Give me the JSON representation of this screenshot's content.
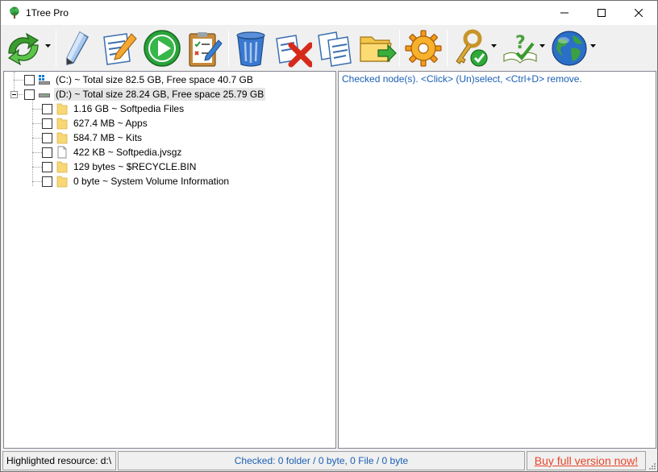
{
  "window": {
    "title": "1Tree Pro",
    "icon": "tree-icon"
  },
  "toolbar": {
    "buttons": [
      {
        "name": "refresh-icon",
        "dropdown": true
      },
      {
        "name": "pencil-icon",
        "dropdown": false
      },
      {
        "name": "edit-notes-icon",
        "dropdown": false
      },
      {
        "name": "play-icon",
        "dropdown": false
      },
      {
        "name": "checklist-icon",
        "dropdown": false
      },
      {
        "name": "trash-icon",
        "dropdown": false
      },
      {
        "name": "remove-icon",
        "dropdown": false
      },
      {
        "name": "copy-icon",
        "dropdown": false
      },
      {
        "name": "move-folder-icon",
        "dropdown": false
      },
      {
        "name": "settings-gear-icon",
        "dropdown": false
      },
      {
        "name": "key-register-icon",
        "dropdown": true
      },
      {
        "name": "help-icon",
        "dropdown": true
      },
      {
        "name": "globe-icon",
        "dropdown": true
      }
    ]
  },
  "tree": {
    "drives": [
      {
        "label": "(C:) ~ Total size 82.5 GB, Free space 40.7 GB",
        "icon": "windows-drive-icon"
      },
      {
        "label": "(D:) ~ Total size 28.24 GB, Free space 25.79 GB",
        "icon": "drive-icon",
        "expanded": true
      }
    ],
    "children": [
      {
        "label": "1.16 GB ~ Softpedia Files",
        "icon": "folder-icon"
      },
      {
        "label": "627.4 MB ~ Apps",
        "icon": "folder-icon"
      },
      {
        "label": "584.7 MB ~ Kits",
        "icon": "folder-icon"
      },
      {
        "label": "422 KB ~ Softpedia.jvsgz",
        "icon": "file-icon"
      },
      {
        "label": "129 bytes ~ $RECYCLE.BIN",
        "icon": "folder-icon"
      },
      {
        "label": "0 byte ~ System Volume Information",
        "icon": "folder-icon"
      }
    ]
  },
  "info": {
    "text": "Checked node(s). <Click> (Un)select, <Ctrl+D> remove."
  },
  "status": {
    "highlighted": "Highlighted resource: d:\\",
    "checked": "Checked:  0 folder / 0  byte, 0 File / 0  byte",
    "buy": "Buy full version now!"
  },
  "colors": {
    "info_text": "#1a5fb4",
    "buy_link": "#e8462a",
    "folder": "#f8d775"
  }
}
